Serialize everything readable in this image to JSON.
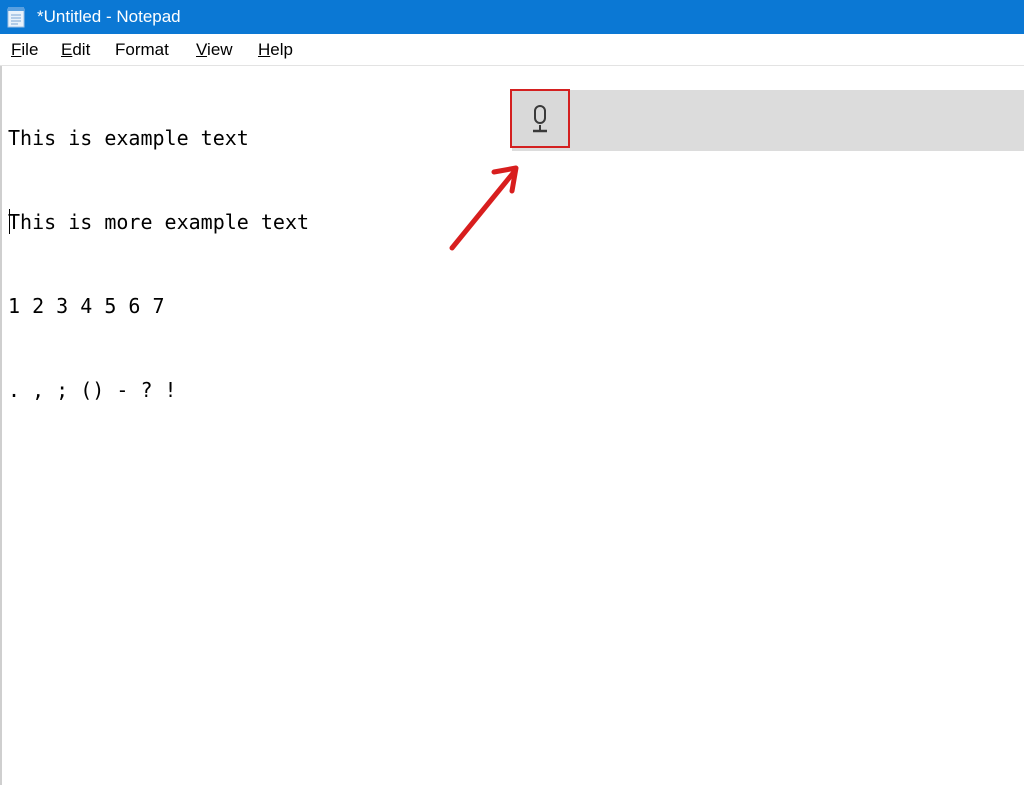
{
  "window": {
    "title": "*Untitled - Notepad",
    "titlebar_color": "#0b78d4",
    "app_icon": "notepad-icon"
  },
  "menu": {
    "items": [
      {
        "label": "File",
        "accel": "F",
        "rest": "ile"
      },
      {
        "label": "Edit",
        "accel": "E",
        "rest": "dit"
      },
      {
        "label": "Format",
        "accel": "",
        "rest": "Format"
      },
      {
        "label": "View",
        "accel": "V",
        "rest": "iew"
      },
      {
        "label": "Help",
        "accel": "H",
        "rest": "elp"
      }
    ]
  },
  "editor": {
    "lines": [
      "This is example text",
      "This is more example text",
      "1 2 3 4 5 6 7",
      ". , ; () - ? !",
      ""
    ]
  },
  "dictation": {
    "icon": "microphone-icon",
    "highlight_color": "#d42020",
    "annotation_icon": "red-arrow-icon"
  }
}
